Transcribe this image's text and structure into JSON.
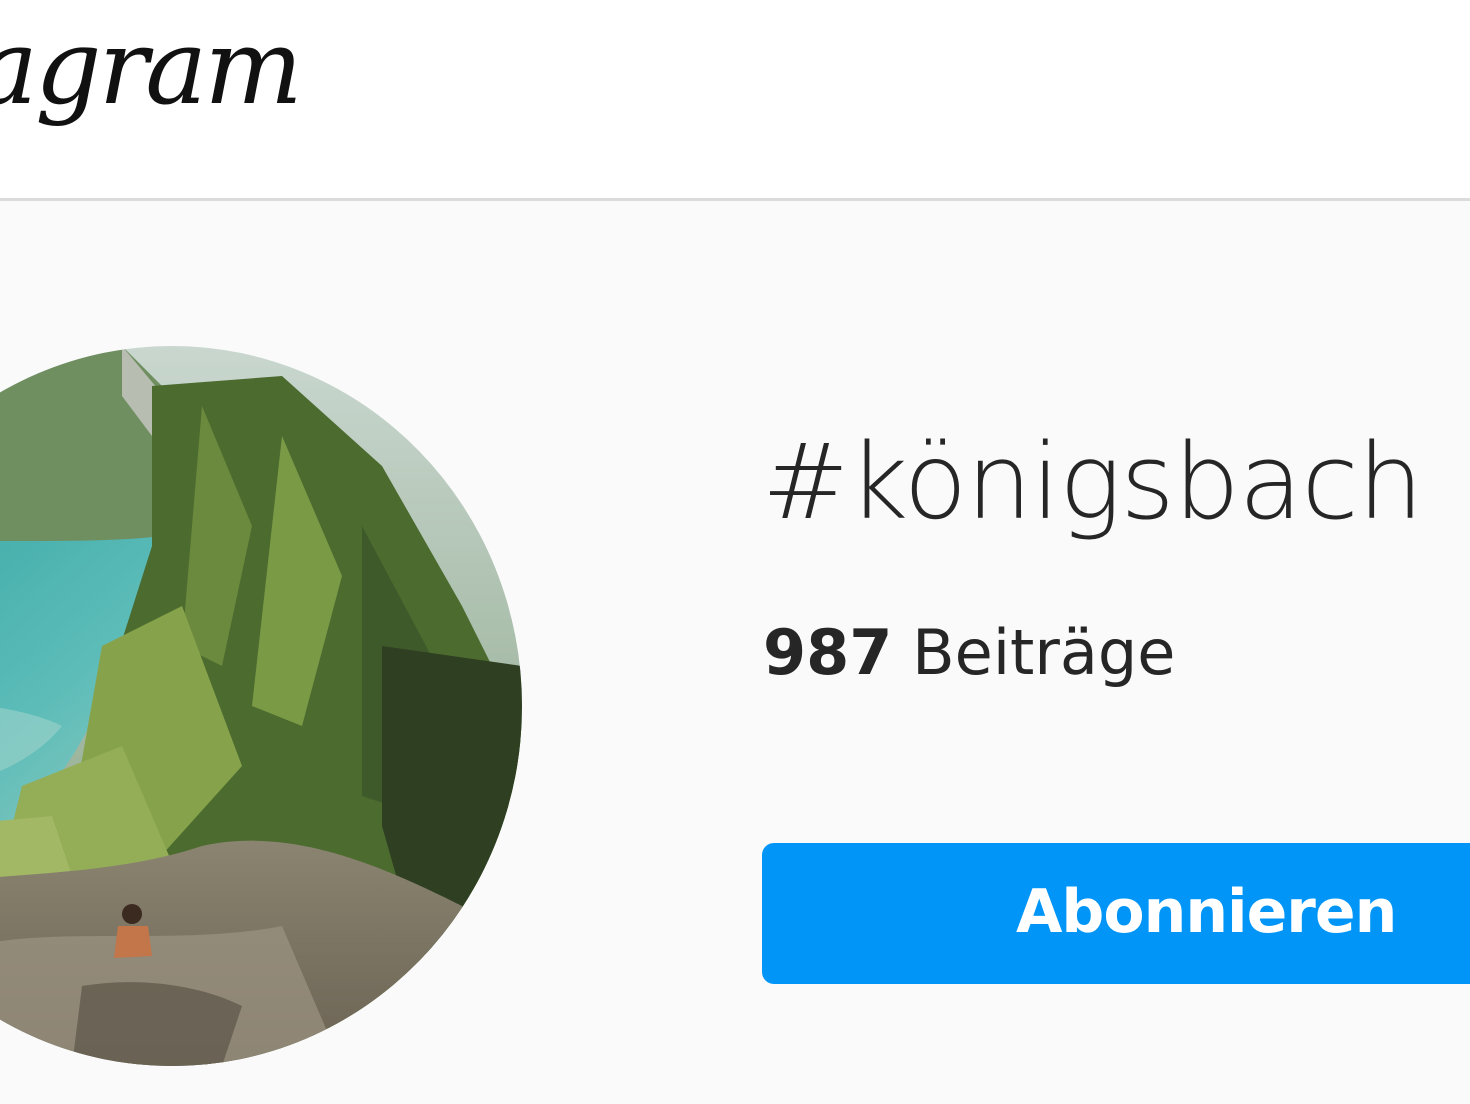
{
  "header": {
    "logo_text": "Instagram",
    "logo_visible": "agram"
  },
  "hashtag": {
    "title": "#königsbach",
    "post_count": "987",
    "post_label": "Beiträge"
  },
  "actions": {
    "follow_label": "Abonnieren"
  },
  "colors": {
    "accent": "#0095f6",
    "background": "#fafafa",
    "header_bg": "#ffffff",
    "text": "#262626",
    "divider": "#dbdbdb"
  }
}
